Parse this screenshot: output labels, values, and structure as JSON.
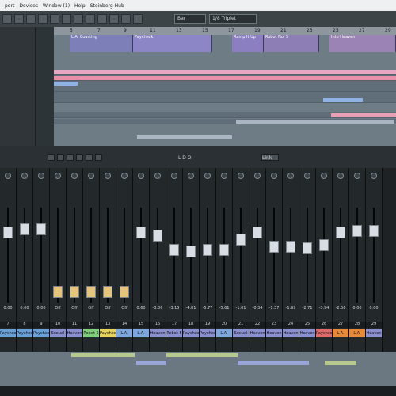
{
  "menubar": {
    "items": [
      "port",
      "Devices",
      "Window (1)",
      "Help",
      "Steinberg Hub"
    ]
  },
  "toolbar": {
    "quantize": "Bar",
    "grid": "1/8 Triplet"
  },
  "ruler": {
    "bars": [
      "5",
      "7",
      "9",
      "11",
      "13",
      "15",
      "17",
      "19",
      "21",
      "23",
      "25",
      "27",
      "29"
    ]
  },
  "markers": [
    {
      "label": "L.A. Coasting",
      "color": "#7c7fb8"
    },
    {
      "label": "Paycheck",
      "color": "#8d86c6"
    },
    {
      "label": "Ramp It Up",
      "color": "#8b7fc1"
    },
    {
      "label": "Robot No. 5",
      "color": "#8d7fb6"
    },
    {
      "label": "Into Heaven",
      "color": "#9b83b6"
    }
  ],
  "transport": {
    "mode": "L D O",
    "link": "Link"
  },
  "mixer": {
    "channels": [
      {
        "num": "7",
        "name": "Paycheck",
        "vol": "0.00",
        "color": "#6aa0d8",
        "level": 0.78
      },
      {
        "num": "8",
        "name": "Paycheck",
        "vol": "0.00",
        "color": "#6aa0d8",
        "level": 0.82
      },
      {
        "num": "9",
        "name": "Paycheck",
        "vol": "0.00",
        "color": "#6aa0d8",
        "level": 0.82
      },
      {
        "num": "10",
        "name": "Sexual Healing",
        "vol": "Off",
        "color": "#8a8fd0",
        "level": 0.1
      },
      {
        "num": "11",
        "name": "Heaven",
        "vol": "Off",
        "color": "#8a8fd0",
        "level": 0.1
      },
      {
        "num": "12",
        "name": "Robot 5",
        "vol": "Off",
        "color": "#7fcf7a",
        "level": 0.1
      },
      {
        "num": "13",
        "name": "Paycheck",
        "vol": "Off",
        "color": "#e6d35c",
        "level": 0.1
      },
      {
        "num": "14",
        "name": "L.A. Coasting",
        "vol": "Off",
        "color": "#7ea7dd",
        "level": 0.1
      },
      {
        "num": "15",
        "name": "L.A. Coasting",
        "vol": "0.60",
        "color": "#7ea7dd",
        "level": 0.78
      },
      {
        "num": "16",
        "name": "Heaven",
        "vol": "-3.06",
        "color": "#8a8fd0",
        "level": 0.75
      },
      {
        "num": "17",
        "name": "Robot 5",
        "vol": "-3.15",
        "color": "#8a8fd0",
        "level": 0.58
      },
      {
        "num": "18",
        "name": "Paycheck",
        "vol": "-4.81",
        "color": "#8a8fd0",
        "level": 0.56
      },
      {
        "num": "19",
        "name": "Paycheck",
        "vol": "-5.77",
        "color": "#8a8fd0",
        "level": 0.58
      },
      {
        "num": "20",
        "name": "L.A. Coasting",
        "vol": "-5.61",
        "color": "#7ea7dd",
        "level": 0.58
      },
      {
        "num": "21",
        "name": "Sexual Healing",
        "vol": "-1.61",
        "color": "#8a8fd0",
        "level": 0.7
      },
      {
        "num": "22",
        "name": "Heaven",
        "vol": "-0.34",
        "color": "#8a8fd0",
        "level": 0.78
      },
      {
        "num": "23",
        "name": "Heaven",
        "vol": "-1.37",
        "color": "#8a8fd0",
        "level": 0.62
      },
      {
        "num": "24",
        "name": "Heaven",
        "vol": "-1.99",
        "color": "#8a8fd0",
        "level": 0.62
      },
      {
        "num": "25",
        "name": "Heaven",
        "vol": "-2.71",
        "color": "#8a8fd0",
        "level": 0.6
      },
      {
        "num": "26",
        "name": "Paycheck",
        "vol": "-3.94",
        "color": "#e06a6a",
        "level": 0.64
      },
      {
        "num": "27",
        "name": "L.A. Coasting",
        "vol": "-2.56",
        "color": "#e68a3a",
        "level": 0.78
      },
      {
        "num": "28",
        "name": "L.A. Coasting",
        "vol": "0.00",
        "color": "#e68a3a",
        "level": 0.8
      },
      {
        "num": "29",
        "name": "Heaven",
        "vol": "0.00",
        "color": "#8a8fd0",
        "level": 0.8
      }
    ]
  }
}
